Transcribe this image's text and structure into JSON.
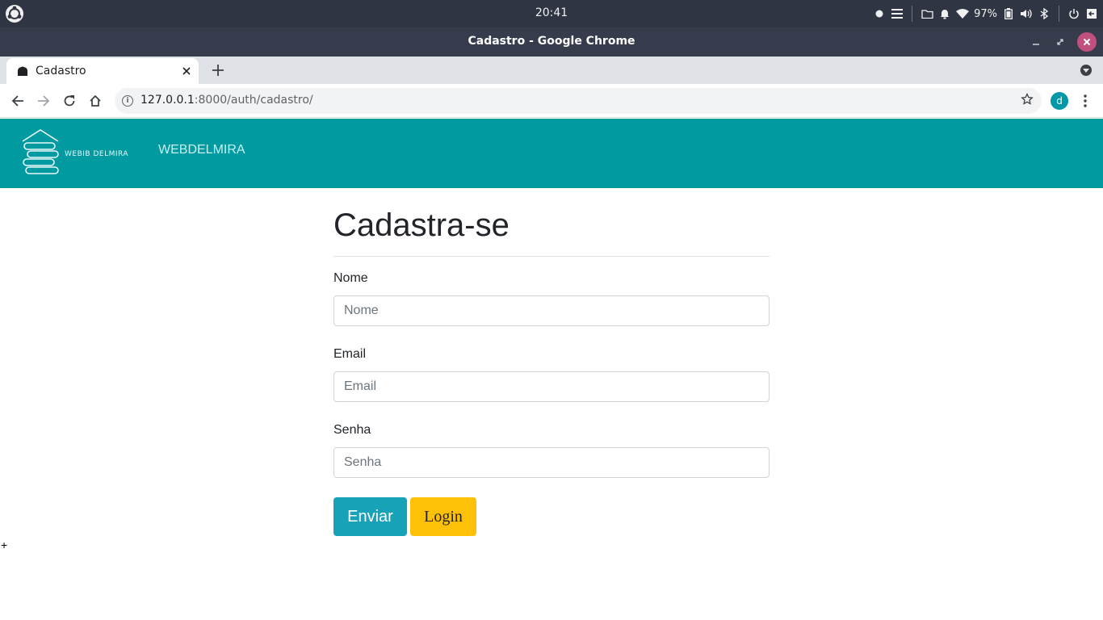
{
  "os": {
    "clock": "20:41",
    "battery": "97%"
  },
  "window": {
    "title": "Cadastro - Google Chrome"
  },
  "browser": {
    "tab_title": "Cadastro",
    "url_host": "127.0.0.1",
    "url_path": ":8000/auth/cadastro/",
    "profile_initial": "d"
  },
  "site": {
    "logo_text": "WEBIB DELMIRA",
    "brand": "WEBDELMIRA"
  },
  "form": {
    "title": "Cadastra-se",
    "nome_label": "Nome",
    "nome_placeholder": "Nome",
    "email_label": "Email",
    "email_placeholder": "Email",
    "senha_label": "Senha",
    "senha_placeholder": "Senha",
    "submit_label": "Enviar",
    "login_label": "Login"
  },
  "misc": {
    "plus_mark": "+"
  },
  "colors": {
    "navbar": "#009aa0",
    "submit": "#17a2b8",
    "login": "#ffc107"
  }
}
